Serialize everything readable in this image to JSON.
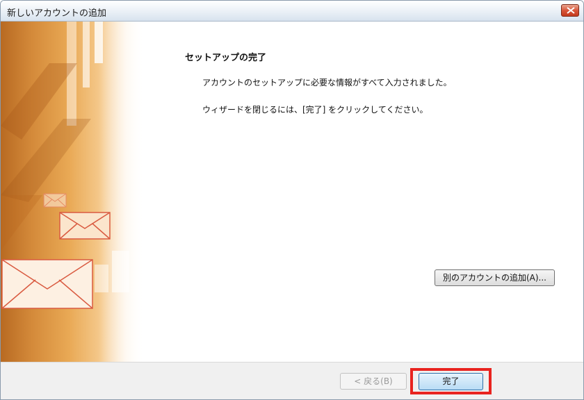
{
  "window": {
    "title": "新しいアカウントの追加"
  },
  "main": {
    "heading": "セットアップの完了",
    "message_1": "アカウントのセットアップに必要な情報がすべて入力されました。",
    "message_2": "ウィザードを閉じるには、[完了] をクリックしてください。",
    "add_account_label": "別のアカウントの追加(A)..."
  },
  "footer": {
    "back_label": "< 戻る(B)",
    "finish_label": "完了"
  },
  "colors": {
    "highlight": "#e8231f",
    "art_orange": "#d48a3a",
    "close_button": "#d8563a"
  }
}
